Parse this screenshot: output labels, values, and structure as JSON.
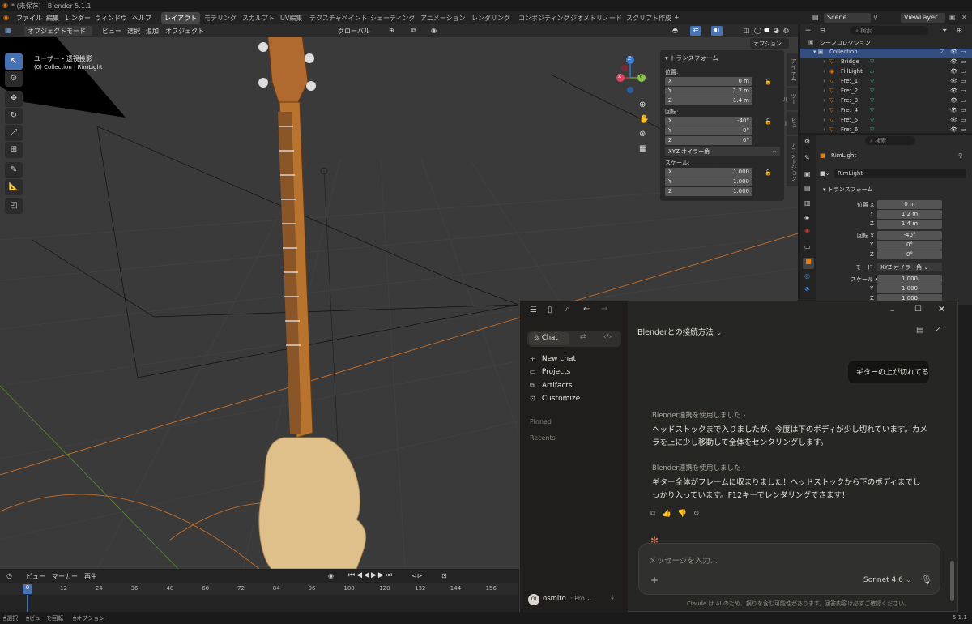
{
  "window": {
    "title": "* (未保存) - Blender 5.1.1"
  },
  "menu": {
    "items": [
      "ファイル",
      "編集",
      "レンダー",
      "ウィンドウ",
      "ヘルプ"
    ]
  },
  "workspaces": [
    "レイアウト",
    "モデリング",
    "スカルプト",
    "UV編集",
    "テクスチャペイント",
    "シェーディング",
    "アニメーション",
    "レンダリング",
    "コンポジティング",
    "ジオメトリノード",
    "スクリプト作成",
    "+"
  ],
  "scene": {
    "scene_name": "Scene",
    "view_layer": "ViewLayer"
  },
  "viewport_header": {
    "mode": "オブジェクトモード",
    "menus": [
      "ビュー",
      "選択",
      "追加",
      "オブジェクト"
    ],
    "orientation": "グローバル",
    "options": "オプション"
  },
  "viewport": {
    "view_name": "ユーザー・透視投影",
    "collection_info": "(0) Collection | RimLight"
  },
  "gizmo": {
    "x": "X",
    "y": "Y",
    "z": "Z"
  },
  "npanel": {
    "title": "トランスフォーム",
    "location_label": "位置:",
    "location": [
      {
        "axis": "X",
        "value": "0 m"
      },
      {
        "axis": "Y",
        "value": "1.2 m"
      },
      {
        "axis": "Z",
        "value": "1.4 m"
      }
    ],
    "rotation_label": "回転:",
    "rotation": [
      {
        "axis": "X",
        "value": "-40°"
      },
      {
        "axis": "Y",
        "value": "0°"
      },
      {
        "axis": "Z",
        "value": "0°"
      }
    ],
    "rotation_mode": "XYZ オイラー角",
    "scale_label": "スケール:",
    "scale": [
      {
        "axis": "X",
        "value": "1.000"
      },
      {
        "axis": "Y",
        "value": "1.000"
      },
      {
        "axis": "Z",
        "value": "1.000"
      }
    ],
    "tabs": [
      "アイテム",
      "ツール",
      "ビュー",
      "アニメーション"
    ]
  },
  "outliner": {
    "search_placeholder": "検索",
    "scene_collection": "シーンコレクション",
    "collection": "Collection",
    "items": [
      "Bridge",
      "FillLight",
      "Fret_1",
      "Fret_2",
      "Fret_3",
      "Fret_4",
      "Fret_5",
      "Fret_6"
    ]
  },
  "properties": {
    "search_placeholder": "検索",
    "object_name": "RimLight",
    "object_field": "RimLight",
    "section": "トランスフォーム",
    "location_label": "位置 X",
    "location": [
      "0 m",
      "1.2 m",
      "1.4 m"
    ],
    "rotation_label": "回転 X",
    "rotation": [
      "-40°",
      "0°",
      "0°"
    ],
    "mode_label": "モード",
    "mode_value": "XYZ オイラー角",
    "scale_label": "スケール X",
    "scale": [
      "1.000",
      "1.000",
      "1.000"
    ],
    "axis_y": "Y",
    "axis_z": "Z"
  },
  "timeline": {
    "menus": [
      "ビュー",
      "マーカー",
      "再生"
    ],
    "current_frame": "0",
    "ticks": [
      "12",
      "24",
      "36",
      "48",
      "60",
      "72",
      "84",
      "96",
      "108",
      "120",
      "132",
      "144",
      "156"
    ]
  },
  "statusbar": {
    "items": [
      "選択",
      "ビューを回転",
      "オプション"
    ],
    "version": "5.1.1"
  },
  "claude": {
    "side_tabs": {
      "chat": "Chat"
    },
    "nav": [
      {
        "icon": "plus-icon",
        "label": "New chat"
      },
      {
        "icon": "projects-icon",
        "label": "Projects"
      },
      {
        "icon": "artifacts-icon",
        "label": "Artifacts"
      },
      {
        "icon": "customize-icon",
        "label": "Customize"
      }
    ],
    "pinned": "Pinned",
    "recents": "Recents",
    "user": {
      "initials": "OI",
      "name": "osmito",
      "plan": "Pro"
    },
    "conversation_title": "Blenderとの接続方法",
    "user_message": "ギターの上が切れてる",
    "tool_use_1": "Blender連携を使用しました",
    "assistant_1": "ヘッドストックまで入りましたが、今度は下のボディが少し切れています。カメラを上に少し移動して全体をセンタリングします。",
    "tool_use_2": "Blender連携を使用しました",
    "assistant_2": "ギター全体がフレームに収まりました！ヘッドストックから下のボディまでしっかり入っています。F12キーでレンダリングできます！",
    "input_placeholder": "メッセージを入力...",
    "model": "Sonnet 4.6",
    "disclaimer": "Claude は AI のため、誤りを含む可能性があります。回答内容は必ずご確認ください。"
  },
  "colors": {
    "accent": "#4772b3",
    "claude_orange": "#d97757",
    "wood": "#b06a30"
  }
}
